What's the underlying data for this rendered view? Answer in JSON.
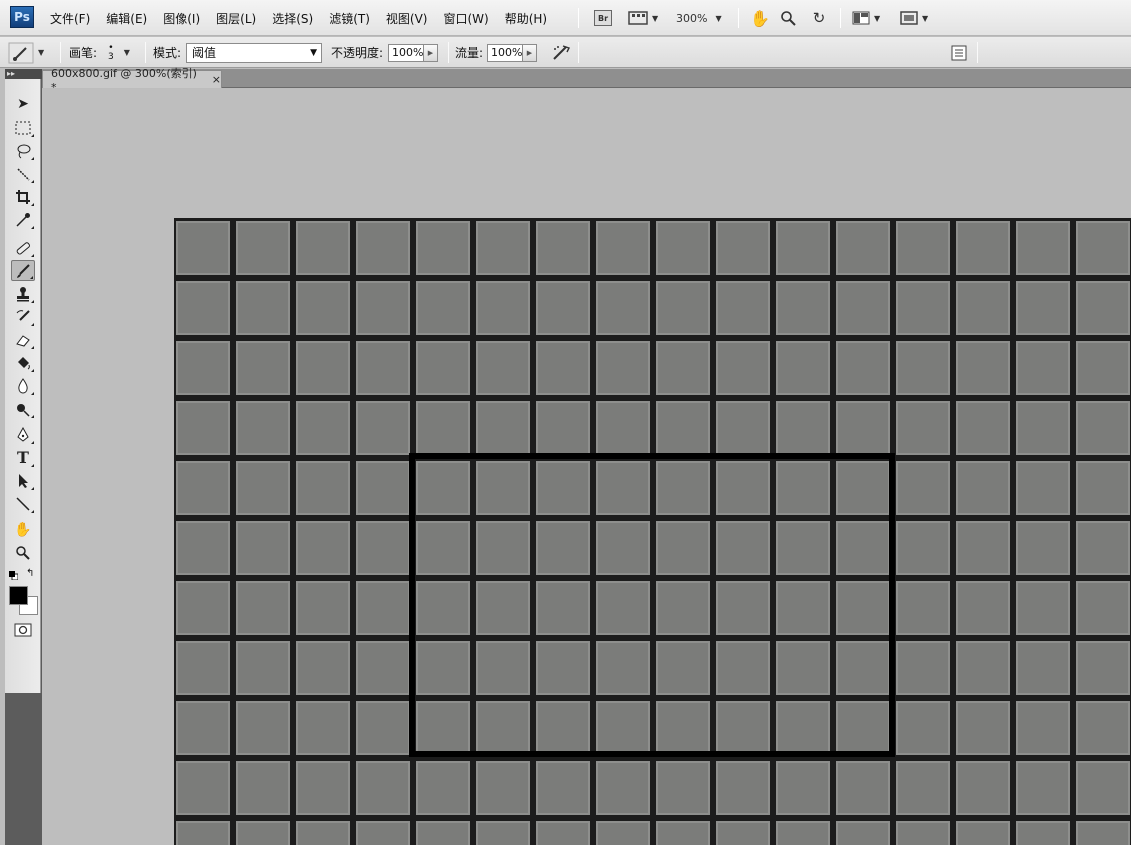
{
  "app": {
    "logo": "Ps"
  },
  "menu": {
    "items": [
      "文件(F)",
      "编辑(E)",
      "图像(I)",
      "图层(L)",
      "选择(S)",
      "滤镜(T)",
      "视图(V)",
      "窗口(W)",
      "帮助(H)"
    ],
    "bridge_label": "Br",
    "zoom": "300%"
  },
  "options": {
    "brush_label": "画笔:",
    "brush_size": "3",
    "mode_label": "模式:",
    "mode_value": "阈值",
    "opacity_label": "不透明度:",
    "opacity_value": "100%",
    "flow_label": "流量:",
    "flow_value": "100%"
  },
  "document": {
    "tab_title": "600x800.gif @ 300%(索引) *",
    "close": "×"
  },
  "toolbox": {
    "collapse": "▸▸",
    "tools": [
      "move-tool",
      "marquee-tool",
      "lasso-tool",
      "magic-wand-tool",
      "crop-tool",
      "eyedropper-tool",
      "healing-brush-tool",
      "brush-tool",
      "clone-stamp-tool",
      "history-brush-tool",
      "eraser-tool",
      "paint-bucket-tool",
      "blur-tool",
      "dodge-tool",
      "pen-tool",
      "type-tool",
      "path-selection-tool",
      "line-tool",
      "hand-tool",
      "zoom-tool"
    ],
    "type_glyph": "T",
    "active_tool": "brush-tool",
    "foreground_color": "#000000",
    "background_color": "#ffffff"
  },
  "canvas": {
    "cell_color": "#7b7c7a",
    "line_color": "#1a1a1a",
    "selection_color": "#000000"
  }
}
